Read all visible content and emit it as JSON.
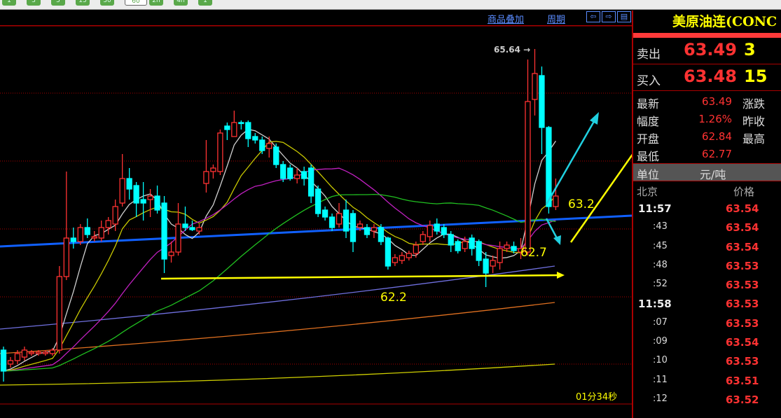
{
  "toolbar": {
    "periods": [
      "1",
      "3",
      "5",
      "15",
      "30",
      "60",
      "2h",
      "4h",
      "1"
    ],
    "selected": 5
  },
  "chart_header": {
    "overlay": "商品叠加",
    "period": "周期",
    "icons": [
      "scroll-left-icon",
      "scroll-right-icon",
      "layout-icon"
    ]
  },
  "chart_data": {
    "type": "candlestick",
    "ylim": [
      60.8,
      66.3
    ],
    "colors": {
      "up": "#ff3232",
      "down": "#00ffff",
      "ma5": "#d0d0d0",
      "ma10": "#c8c800",
      "ma20": "#c020c0",
      "ma40": "#20c020"
    },
    "high_label": "65.64",
    "candles_ohlc": [
      [
        61.34,
        61.39,
        60.89,
        61.04
      ],
      [
        61.14,
        61.24,
        61.09,
        61.19
      ],
      [
        61.19,
        61.34,
        61.14,
        61.29
      ],
      [
        61.24,
        61.39,
        61.19,
        61.34
      ],
      [
        61.29,
        61.34,
        61.26,
        61.31
      ],
      [
        61.29,
        61.34,
        61.26,
        61.31
      ],
      [
        61.29,
        61.34,
        61.26,
        61.31
      ],
      [
        61.29,
        61.37,
        61.26,
        61.34
      ],
      [
        61.34,
        62.54,
        61.29,
        62.39
      ],
      [
        62.39,
        63.89,
        62.34,
        62.94
      ],
      [
        62.94,
        63.09,
        62.79,
        62.89
      ],
      [
        62.89,
        63.14,
        62.84,
        63.09
      ],
      [
        63.09,
        63.22,
        62.94,
        62.99
      ],
      [
        62.94,
        63.04,
        62.89,
        62.96
      ],
      [
        62.94,
        63.19,
        62.89,
        63.09
      ],
      [
        63.09,
        63.24,
        62.99,
        63.19
      ],
      [
        63.14,
        63.49,
        63.04,
        63.39
      ],
      [
        63.44,
        64.14,
        63.39,
        63.79
      ],
      [
        63.79,
        63.94,
        63.49,
        63.64
      ],
      [
        63.69,
        63.74,
        63.24,
        63.44
      ],
      [
        63.49,
        63.74,
        63.19,
        63.44
      ],
      [
        63.49,
        63.64,
        63.24,
        63.54
      ],
      [
        63.54,
        63.69,
        63.29,
        63.34
      ],
      [
        63.44,
        63.54,
        62.44,
        62.64
      ],
      [
        62.69,
        62.89,
        62.59,
        62.74
      ],
      [
        62.74,
        63.44,
        62.69,
        63.14
      ],
      [
        63.14,
        63.39,
        63.04,
        63.09
      ],
      [
        63.09,
        63.19,
        63.04,
        63.06
      ],
      [
        63.04,
        63.14,
        62.99,
        63.09
      ],
      [
        63.72,
        64.34,
        63.59,
        63.89
      ],
      [
        63.89,
        63.99,
        63.79,
        63.94
      ],
      [
        63.89,
        64.49,
        63.84,
        64.44
      ],
      [
        64.54,
        64.59,
        64.34,
        64.49
      ],
      [
        64.39,
        64.76,
        64.39,
        64.59
      ],
      [
        64.59,
        64.62,
        64.49,
        64.585
      ],
      [
        64.59,
        64.62,
        64.24,
        64.36
      ],
      [
        64.39,
        64.44,
        64.29,
        64.34
      ],
      [
        64.34,
        64.39,
        64.14,
        64.19
      ],
      [
        64.22,
        64.39,
        64.09,
        64.29
      ],
      [
        64.24,
        64.29,
        63.94,
        63.99
      ],
      [
        63.99,
        64.04,
        63.74,
        63.79
      ],
      [
        63.94,
        63.99,
        63.76,
        63.79
      ],
      [
        63.79,
        63.94,
        63.72,
        63.84
      ],
      [
        63.89,
        63.96,
        63.69,
        63.79
      ],
      [
        63.94,
        63.99,
        63.44,
        63.54
      ],
      [
        63.64,
        63.69,
        63.24,
        63.29
      ],
      [
        63.34,
        63.39,
        63.19,
        63.24
      ],
      [
        63.24,
        63.29,
        63.04,
        63.09
      ],
      [
        63.14,
        63.44,
        63.09,
        63.29
      ],
      [
        63.34,
        63.49,
        62.94,
        63.04
      ],
      [
        63.29,
        63.34,
        62.74,
        62.89
      ],
      [
        63.09,
        63.19,
        63.04,
        63.14
      ],
      [
        63.09,
        63.14,
        62.94,
        62.99
      ],
      [
        63.04,
        63.14,
        62.94,
        63.09
      ],
      [
        63.09,
        63.14,
        62.84,
        62.89
      ],
      [
        62.94,
        62.96,
        62.49,
        62.54
      ],
      [
        62.59,
        62.71,
        62.54,
        62.66
      ],
      [
        62.62,
        62.74,
        62.57,
        62.69
      ],
      [
        62.66,
        62.76,
        62.62,
        62.72
      ],
      [
        62.72,
        62.89,
        62.66,
        62.84
      ],
      [
        62.89,
        63.04,
        62.84,
        62.99
      ],
      [
        62.96,
        63.19,
        62.89,
        63.12
      ],
      [
        63.14,
        63.22,
        62.99,
        63.04
      ],
      [
        63.09,
        63.14,
        62.94,
        62.99
      ],
      [
        62.99,
        63.04,
        62.74,
        62.84
      ],
      [
        62.89,
        62.92,
        62.72,
        62.76
      ],
      [
        62.79,
        62.96,
        62.74,
        62.89
      ],
      [
        62.94,
        62.99,
        62.69,
        62.79
      ],
      [
        62.89,
        62.92,
        62.54,
        62.62
      ],
      [
        62.64,
        62.74,
        62.24,
        62.44
      ],
      [
        62.54,
        62.69,
        62.44,
        62.62
      ],
      [
        62.59,
        62.89,
        62.49,
        62.79
      ],
      [
        62.79,
        62.89,
        62.74,
        62.84
      ],
      [
        62.82,
        62.89,
        62.72,
        62.76
      ],
      [
        62.74,
        62.94,
        62.64,
        62.79
      ],
      [
        62.74,
        65.49,
        62.69,
        64.89
      ],
      [
        64.92,
        65.64,
        64.69,
        65.29
      ],
      [
        65.26,
        65.39,
        64.14,
        64.52
      ],
      [
        64.52,
        64.54,
        63.29,
        63.39
      ],
      [
        63.39,
        63.79,
        63.34,
        63.54
      ]
    ],
    "long_lines": [
      {
        "name": "ma-long-1",
        "color": "#7070e0",
        "from": 61.64,
        "to": 62.54
      },
      {
        "name": "ma-long-2",
        "color": "#e07020",
        "from": 61.29,
        "to": 62.02
      },
      {
        "name": "ma-long-3",
        "color": "#d0d000",
        "from": 60.84,
        "to": 61.14
      }
    ],
    "trendline": {
      "color": "#1060ff",
      "from": 62.82,
      "to": 63.26
    },
    "support_line": {
      "color": "#ffff00",
      "from": 62.36,
      "to": 62.41
    },
    "annotations": [
      "63.2",
      "62.7",
      "62.2"
    ]
  },
  "timer": "01分34秒",
  "panel": {
    "title": "美原油连(CONC",
    "sell": {
      "label": "卖出",
      "price": "63.49",
      "volume": "3"
    },
    "buy": {
      "label": "买入",
      "price": "63.48",
      "volume": "15"
    },
    "info": [
      {
        "label": "最新",
        "value": "63.49",
        "label2": "涨跌"
      },
      {
        "label": "幅度",
        "value": "1.26%",
        "label2": "昨收"
      },
      {
        "label": "开盘",
        "value": "62.84",
        "label2": "最高"
      },
      {
        "label": "最低",
        "value": "62.77",
        "label2": ""
      }
    ],
    "unit": {
      "label": "单位",
      "value": "元/吨"
    },
    "ticks_header": {
      "time": "北京",
      "price": "价格"
    },
    "ticks": [
      {
        "time": "11:57",
        "price": "63.54",
        "major": true
      },
      {
        "time": ":43",
        "price": "63.54"
      },
      {
        "time": ":45",
        "price": "63.54"
      },
      {
        "time": ":48",
        "price": "63.53"
      },
      {
        "time": ":52",
        "price": "63.53"
      },
      {
        "time": "11:58",
        "price": "63.53",
        "major": true
      },
      {
        "time": ":07",
        "price": "63.53"
      },
      {
        "time": ":09",
        "price": "63.54"
      },
      {
        "time": ":10",
        "price": "63.53"
      },
      {
        "time": ":11",
        "price": "63.51"
      },
      {
        "time": ":12",
        "price": "63.52"
      }
    ]
  }
}
